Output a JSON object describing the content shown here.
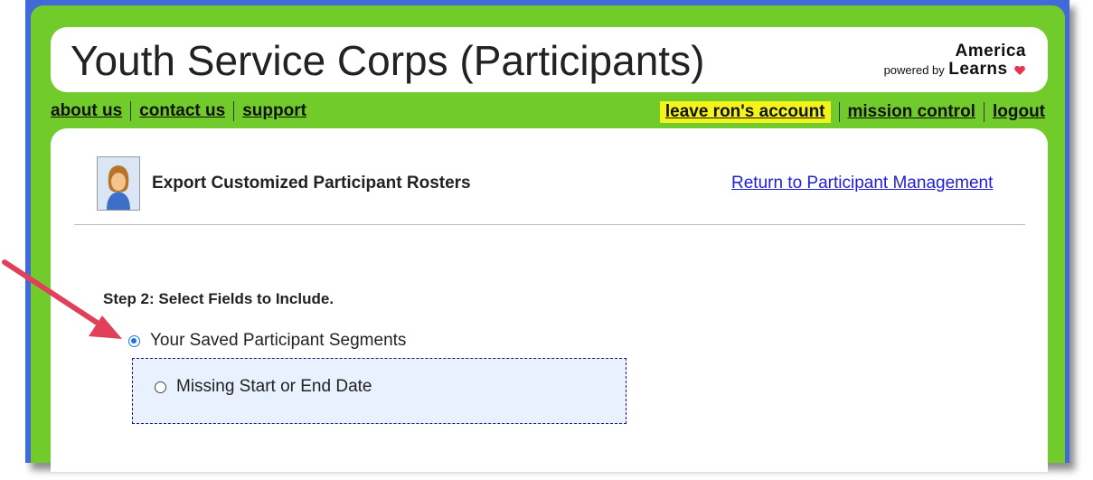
{
  "header": {
    "title": "Youth Service Corps (Participants)",
    "brand_top": "America",
    "brand_powered": "powered by",
    "brand_learns": "Learns",
    "heart_icon": "heart-icon",
    "heart_color": "#e8344f"
  },
  "nav": {
    "left": [
      "about us",
      "contact us",
      "support"
    ],
    "right": [
      "leave ron's account",
      "mission control",
      "logout"
    ],
    "highlight_color": "#f5f31c"
  },
  "page": {
    "title": "Export Customized Participant Rosters",
    "return_link": "Return to Participant Management",
    "avatar_icon": "user-avatar-icon"
  },
  "step": {
    "label": "Step 2: Select Fields to Include.",
    "saved_segments": "Your Saved Participant Segments",
    "saved_checked": true,
    "segments": [
      {
        "label": "Missing Start or End Date",
        "checked": false
      }
    ]
  },
  "annotation": {
    "arrow_color": "#e0405a"
  },
  "colors": {
    "frame_blue": "#4169d8",
    "app_green": "#71cc2b",
    "link_blue": "#1f1fd6",
    "radio_blue": "#1a73e8",
    "segment_bg": "#e9f1ff"
  }
}
